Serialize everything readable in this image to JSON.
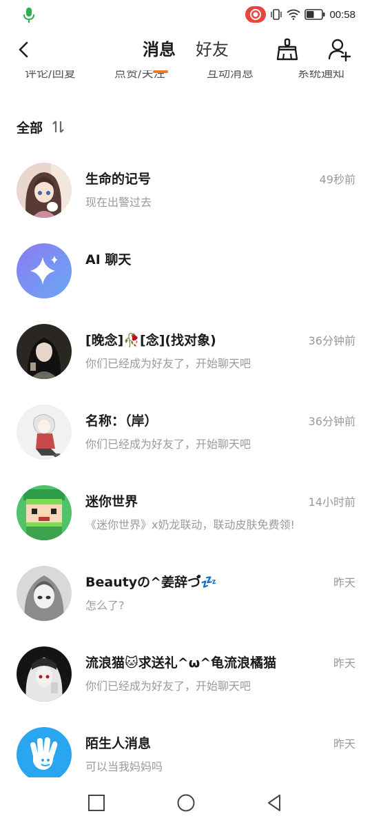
{
  "status_bar": {
    "time": "00:58",
    "icons": [
      "mic-icon",
      "screen-record-icon",
      "vibrate-icon",
      "wifi-icon",
      "battery-icon"
    ],
    "battery_level": 0.5
  },
  "header": {
    "tabs": [
      {
        "label": "消息",
        "active": true
      },
      {
        "label": "好友",
        "active": false
      }
    ],
    "icons": [
      "back-arrow-icon",
      "broom-icon",
      "add-friend-icon"
    ]
  },
  "categories": [
    {
      "label": "评论/回复"
    },
    {
      "label": "点赞/关注"
    },
    {
      "label": "互动消息"
    },
    {
      "label": "系统通知"
    }
  ],
  "filter": {
    "label": "全部",
    "sort_icon": "sort-icon"
  },
  "conversations": [
    {
      "name": "生命的记号",
      "time": "49秒前",
      "preview": "现在出警过去"
    },
    {
      "name": "AI 聊天",
      "time": "",
      "preview": ""
    },
    {
      "name": "[晚念]🥀[念](找对象)",
      "time": "36分钟前",
      "preview": "你们已经成为好友了，开始聊天吧"
    },
    {
      "name": "名称：（岸）",
      "time": "36分钟前",
      "preview": "你们已经成为好友了，开始聊天吧"
    },
    {
      "name": "迷你世界",
      "time": "14小时前",
      "preview": "《迷你世界》x奶龙联动，联动皮肤免费领!"
    },
    {
      "name": "Beautyの^姜辞づ゚💤",
      "time": "昨天",
      "preview": "怎么了?"
    },
    {
      "name": "流浪猫🐱求送礼^ω^龟流浪橘猫",
      "time": "昨天",
      "preview": "你们已经成为好友了，开始聊天吧"
    },
    {
      "name": "陌生人消息",
      "time": "昨天",
      "preview": "可以当我妈妈吗"
    }
  ],
  "colors": {
    "accent_orange": "#f07a2a",
    "mic_green": "#2bb24c",
    "record_red": "#e8463c",
    "ai_gradient_start": "#8a7bf2",
    "ai_gradient_end": "#6aa8f5",
    "stranger_blue": "#2aa6f0"
  },
  "nav_bar": {
    "icons": [
      "recent-apps-icon",
      "home-icon",
      "back-icon"
    ]
  }
}
